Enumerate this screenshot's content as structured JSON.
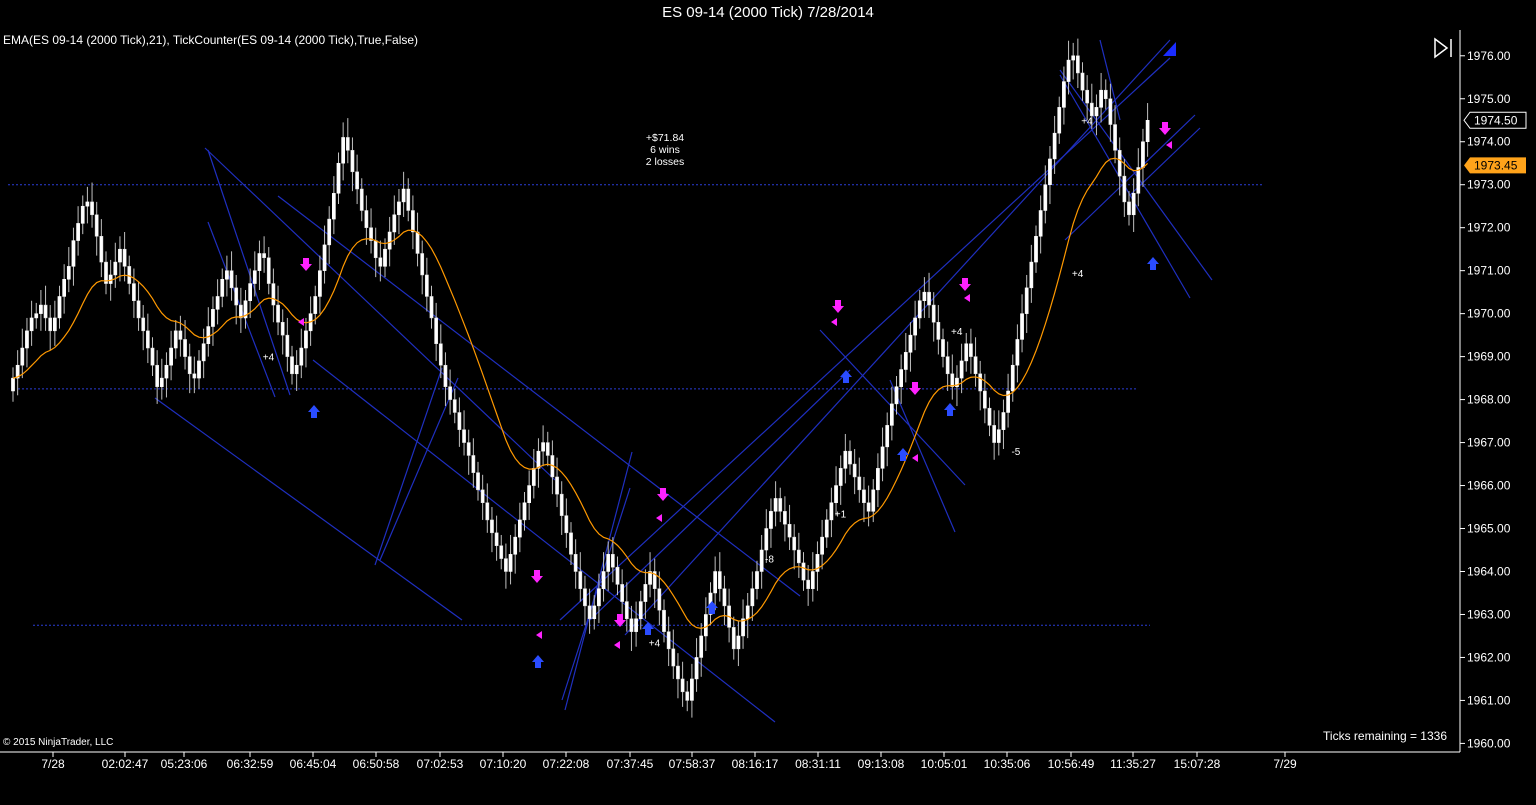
{
  "window": {
    "title": "ES 09-14 (2000 Tick)  7/28/2014"
  },
  "indicator_label": "EMA(ES 09-14 (2000 Tick),21),  TickCounter(ES 09-14 (2000 Tick),True,False)",
  "stats": {
    "pnl": "+$71.84",
    "wins": "6 wins",
    "losses": "2 losses"
  },
  "ticks_remaining": "Ticks remaining = 1336",
  "copyright": "© 2015 NinjaTrader, LLC",
  "buttons": {
    "collapse_icon": "collapse-panel-icon"
  },
  "colors": {
    "background": "#000000",
    "candle_up": "#ffffff",
    "candle_down": "#ffffff",
    "wick": "#c0c0c0",
    "ema": "#ff9900",
    "trendline": "#1f2fbf",
    "dashed_line": "#2a3cd6",
    "short_marker": "#ff22ff",
    "long_marker": "#2a4cff",
    "last_price_box": "#ffffff",
    "ema_price_box": "#ffa31a",
    "axis_text": "#ffffff"
  },
  "chart_data": {
    "type": "candlestick",
    "title": "ES 09-14 (2000 Tick)  7/28/2014",
    "ylim": [
      1959.8,
      1976.6
    ],
    "y_ticks": [
      "1960.00",
      "1961.00",
      "1962.00",
      "1963.00",
      "1964.00",
      "1965.00",
      "1966.00",
      "1967.00",
      "1968.00",
      "1969.00",
      "1970.00",
      "1971.00",
      "1972.00",
      "1973.00",
      "1974.00",
      "1975.00",
      "1976.00"
    ],
    "x_tick_labels": [
      "7/28",
      "02:02:47",
      "05:23:06",
      "06:32:59",
      "06:45:04",
      "06:50:58",
      "07:02:53",
      "07:10:20",
      "07:22:08",
      "07:37:45",
      "07:58:37",
      "08:16:17",
      "08:31:11",
      "09:13:08",
      "10:05:01",
      "10:35:06",
      "10:56:49",
      "11:35:27",
      "15:07:28",
      "7/29"
    ],
    "price_labels": {
      "last": "1974.50",
      "ema": "1973.45"
    },
    "horizontal_lines": [
      1973.0,
      1968.25,
      1962.75
    ],
    "bar_count": 232,
    "close": [
      1968.5,
      1968.8,
      1969.2,
      1969.6,
      1969.9,
      1970.0,
      1970.2,
      1969.9,
      1969.6,
      1969.9,
      1970.4,
      1970.8,
      1971.1,
      1971.7,
      1972.1,
      1972.5,
      1972.6,
      1972.3,
      1971.8,
      1971.2,
      1970.7,
      1970.9,
      1971.2,
      1971.5,
      1971.1,
      1970.7,
      1970.3,
      1969.9,
      1969.6,
      1969.2,
      1968.8,
      1968.3,
      1968.5,
      1968.8,
      1969.2,
      1969.6,
      1969.4,
      1969.0,
      1968.6,
      1968.5,
      1968.9,
      1969.3,
      1969.7,
      1970.1,
      1970.4,
      1970.8,
      1971.0,
      1970.6,
      1970.2,
      1969.9,
      1970.3,
      1970.7,
      1971.0,
      1971.4,
      1971.3,
      1970.7,
      1970.2,
      1969.8,
      1969.5,
      1969.0,
      1968.6,
      1968.8,
      1969.2,
      1969.6,
      1970.0,
      1970.4,
      1971.0,
      1971.6,
      1972.2,
      1972.8,
      1973.5,
      1974.1,
      1973.8,
      1973.3,
      1972.9,
      1972.4,
      1972.0,
      1971.7,
      1971.3,
      1971.1,
      1971.5,
      1971.9,
      1972.3,
      1972.6,
      1972.9,
      1972.4,
      1971.9,
      1971.4,
      1970.9,
      1970.4,
      1969.9,
      1969.3,
      1968.8,
      1968.3,
      1968.0,
      1967.7,
      1967.3,
      1967.0,
      1966.7,
      1966.3,
      1965.9,
      1965.6,
      1965.2,
      1964.9,
      1964.6,
      1964.3,
      1964.0,
      1964.4,
      1964.8,
      1965.2,
      1965.6,
      1966.0,
      1966.4,
      1966.8,
      1967.0,
      1966.7,
      1966.2,
      1965.8,
      1965.3,
      1964.9,
      1964.4,
      1964.0,
      1963.6,
      1963.2,
      1962.9,
      1963.2,
      1963.6,
      1964.0,
      1964.4,
      1964.1,
      1963.7,
      1963.3,
      1962.9,
      1962.6,
      1962.9,
      1963.3,
      1963.7,
      1964.0,
      1963.6,
      1963.1,
      1962.6,
      1962.2,
      1961.8,
      1961.5,
      1961.2,
      1961.0,
      1961.5,
      1962.0,
      1962.5,
      1963.0,
      1963.5,
      1964.0,
      1963.6,
      1963.2,
      1962.7,
      1962.2,
      1962.5,
      1962.9,
      1963.2,
      1963.6,
      1964.0,
      1964.5,
      1965.0,
      1965.4,
      1965.7,
      1965.4,
      1965.1,
      1964.8,
      1964.5,
      1964.2,
      1963.8,
      1963.6,
      1964.0,
      1964.4,
      1964.8,
      1965.2,
      1965.6,
      1966.0,
      1966.4,
      1966.8,
      1966.5,
      1966.2,
      1965.9,
      1965.6,
      1965.4,
      1965.9,
      1966.4,
      1966.9,
      1967.4,
      1967.9,
      1968.3,
      1968.7,
      1969.1,
      1969.5,
      1969.9,
      1970.3,
      1970.5,
      1970.2,
      1969.8,
      1969.4,
      1969.0,
      1968.6,
      1968.3,
      1968.5,
      1968.9,
      1969.3,
      1969.0,
      1968.6,
      1968.2,
      1967.8,
      1967.4,
      1967.0,
      1967.3,
      1967.7,
      1968.2,
      1968.8,
      1969.4,
      1970.0,
      1970.6,
      1971.2,
      1971.8,
      1972.4,
      1973.0,
      1973.6,
      1974.2,
      1974.8,
      1975.4,
      1975.9,
      1976.0,
      1975.6,
      1975.2,
      1974.9,
      1974.6,
      1974.8,
      1975.2,
      1975.0,
      1974.4,
      1973.8,
      1973.2,
      1972.6,
      1972.3,
      1972.8,
      1973.4,
      1974.0,
      1974.5
    ]
  },
  "annotations": [
    {
      "text": "+4",
      "price": 1969.0,
      "bar": 52
    },
    {
      "text": "+4",
      "price": 1962.35,
      "bar": 135
    },
    {
      "text": "-8",
      "price": 1964.3,
      "bar": 160
    },
    {
      "text": "+1",
      "price": 1965.35,
      "bar": 175
    },
    {
      "text": "+4",
      "price": 1969.6,
      "bar": 200
    },
    {
      "text": "-5",
      "price": 1966.8,
      "bar": 213
    },
    {
      "text": "+4",
      "price": 1970.95,
      "bar": 226
    },
    {
      "text": "+4",
      "price": 1974.5,
      "bar": 228
    }
  ]
}
